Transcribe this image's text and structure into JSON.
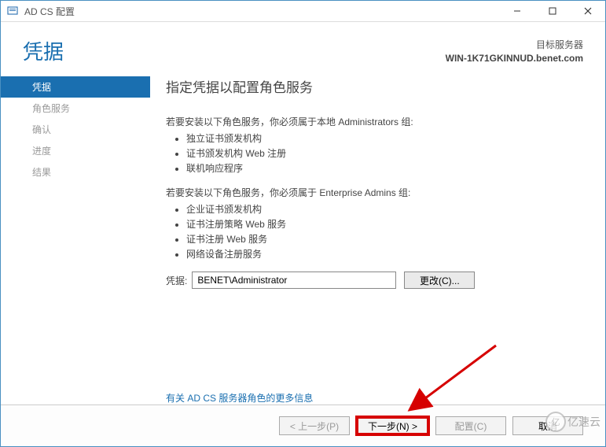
{
  "window": {
    "title": "AD CS 配置"
  },
  "header": {
    "title": "凭据",
    "target_label": "目标服务器",
    "target_host": "WIN-1K71GKINNUD.benet.com"
  },
  "sidebar": {
    "items": [
      {
        "label": "凭据",
        "active": true
      },
      {
        "label": "角色服务",
        "active": false
      },
      {
        "label": "确认",
        "active": false
      },
      {
        "label": "进度",
        "active": false
      },
      {
        "label": "结果",
        "active": false
      }
    ]
  },
  "content": {
    "title": "指定凭据以配置角色服务",
    "intro1": "若要安装以下角色服务，你必须属于本地 Administrators 组:",
    "list1": [
      "独立证书颁发机构",
      "证书颁发机构 Web 注册",
      "联机响应程序"
    ],
    "intro2": "若要安装以下角色服务，你必须属于 Enterprise Admins 组:",
    "list2": [
      "企业证书颁发机构",
      "证书注册策略 Web 服务",
      "证书注册 Web 服务",
      "网络设备注册服务"
    ],
    "cred_label": "凭据:",
    "cred_value": "BENET\\Administrator",
    "change_btn": "更改(C)...",
    "more_link": "有关 AD CS 服务器角色的更多信息"
  },
  "footer": {
    "prev": "< 上一步(P)",
    "next": "下一步(N) >",
    "configure": "配置(C)",
    "cancel": "取消"
  },
  "watermark": "亿速云"
}
